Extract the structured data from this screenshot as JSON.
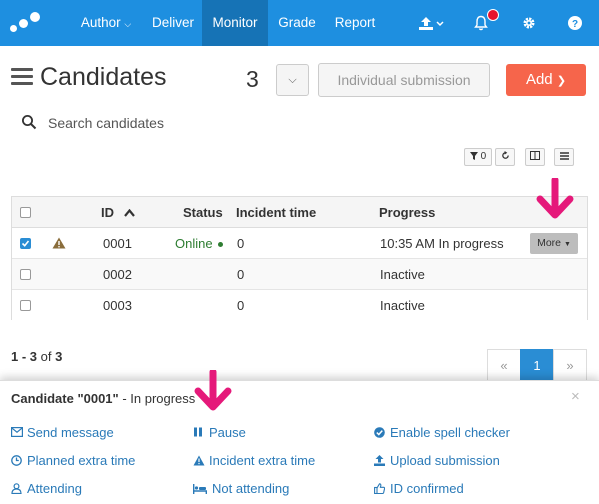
{
  "nav": {
    "items": [
      {
        "label": "Author",
        "has_dropdown": true
      },
      {
        "label": "Deliver"
      },
      {
        "label": "Monitor",
        "active": true
      },
      {
        "label": "Grade"
      },
      {
        "label": "Report"
      }
    ],
    "icons": [
      "upload-icon",
      "bell-icon",
      "gear-icon",
      "help-icon"
    ],
    "notification_dot_color": "#e8112d",
    "bar_color": "#1e8fe0"
  },
  "header": {
    "title": "Candidates",
    "count": "3",
    "individual_submission_label": "Individual submission",
    "add_label": "Add",
    "add_color": "#f6654b"
  },
  "search": {
    "placeholder": "Search candidates"
  },
  "toolbar": {
    "filter_count": "0"
  },
  "table": {
    "columns": [
      "ID",
      "Status",
      "Incident time",
      "Progress"
    ],
    "rows": [
      {
        "checked": true,
        "warning": true,
        "id": "0001",
        "status": "Online",
        "incident_time": "0",
        "progress": "10:35 AM In progress",
        "more_label": "More"
      },
      {
        "checked": false,
        "warning": false,
        "id": "0002",
        "status": "",
        "incident_time": "0",
        "progress": "Inactive"
      },
      {
        "checked": false,
        "warning": false,
        "id": "0003",
        "status": "",
        "incident_time": "0",
        "progress": "Inactive"
      }
    ]
  },
  "pagination": {
    "range": "1 - 3",
    "of_label": "of",
    "total": "3",
    "prev": "«",
    "current": "1",
    "next": "»"
  },
  "panel": {
    "title_prefix": "Candidate \"0001\"",
    "title_suffix": " - In progress",
    "close": "×",
    "actions": {
      "send_message": "Send message",
      "pause": "Pause",
      "enable_spell_checker": "Enable spell checker",
      "planned_extra_time": "Planned extra time",
      "incident_extra_time": "Incident extra time",
      "upload_submission": "Upload submission",
      "attending": "Attending",
      "not_attending": "Not attending",
      "id_confirmed": "ID confirmed"
    }
  },
  "annotation_color": "#e5197a"
}
